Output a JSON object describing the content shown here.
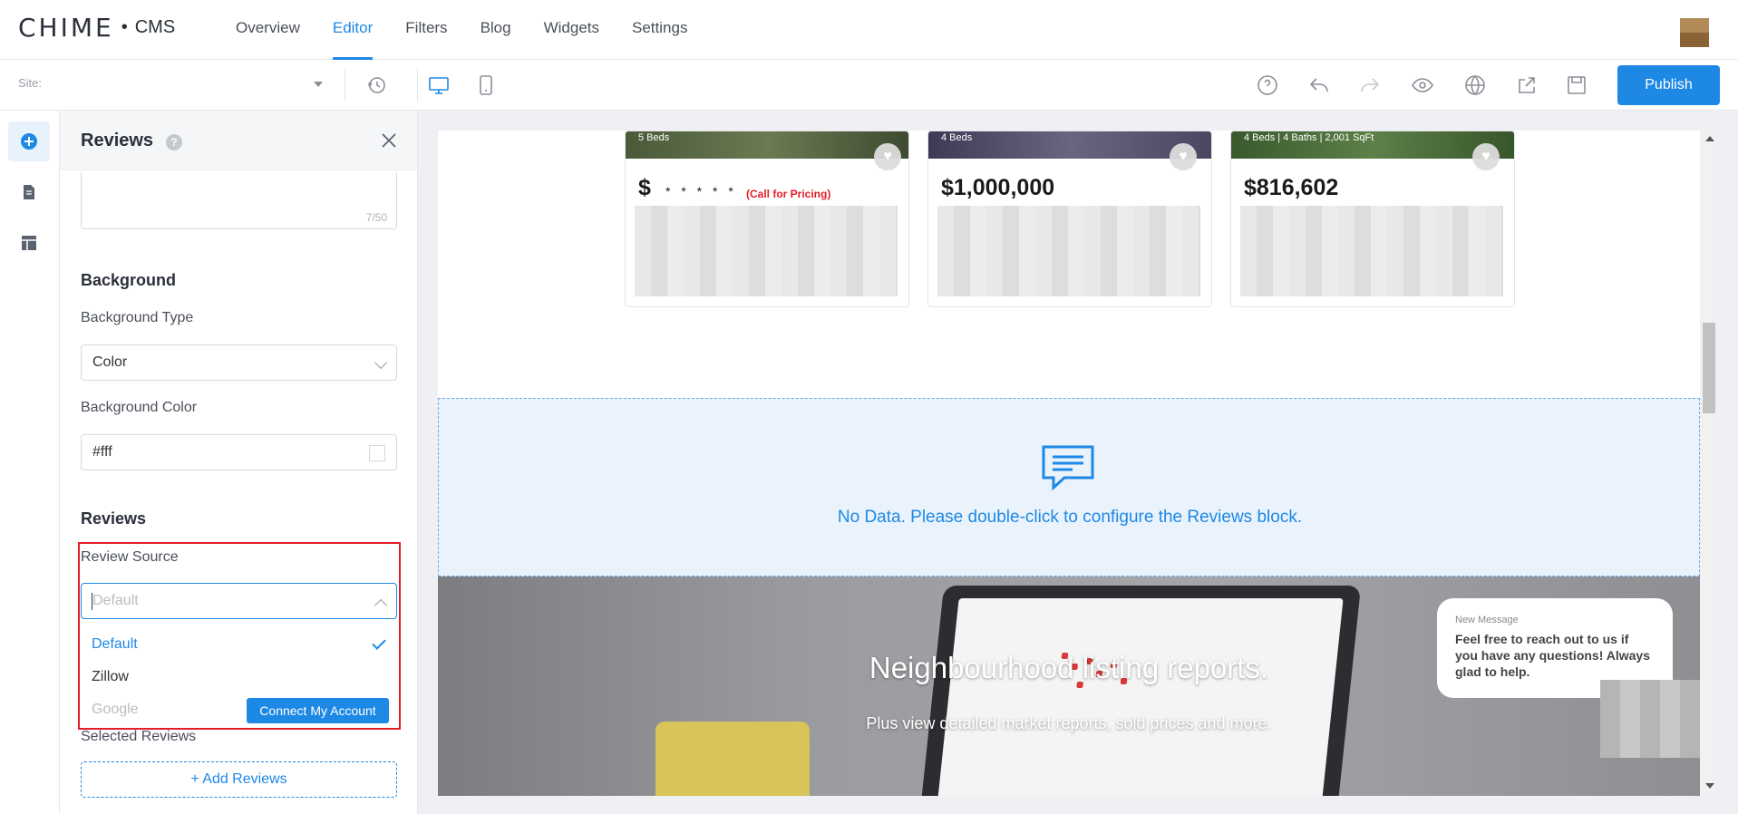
{
  "brand": {
    "logo_text": "CHIME",
    "logo_dot": "•",
    "logo_suffix": "CMS"
  },
  "nav": {
    "items": [
      {
        "label": "Overview"
      },
      {
        "label": "Editor",
        "active": true
      },
      {
        "label": "Filters"
      },
      {
        "label": "Blog"
      },
      {
        "label": "Widgets"
      },
      {
        "label": "Settings"
      }
    ]
  },
  "toolbar": {
    "site_label": "Site:",
    "icons": [
      "history-icon",
      "desktop-icon",
      "mobile-icon",
      "help-icon",
      "undo-icon",
      "redo-icon",
      "preview-icon",
      "globe-icon",
      "share-icon",
      "save-icon"
    ],
    "publish_label": "Publish"
  },
  "colors": {
    "accent": "#1e88e5",
    "highlight": "#e41e26",
    "price_note": "#e41e26"
  },
  "panel": {
    "title": "Reviews",
    "help_glyph": "?",
    "char_count": "7/50",
    "background": {
      "heading": "Background",
      "type_label": "Background Type",
      "type_value": "Color",
      "color_label": "Background Color",
      "color_value": "#fff"
    },
    "reviews": {
      "heading": "Reviews",
      "source_label": "Review Source",
      "source_placeholder": "Default",
      "options": [
        {
          "label": "Default",
          "selected": true
        },
        {
          "label": "Zillow"
        },
        {
          "label": "Google",
          "disabled": true
        }
      ],
      "connect_label": "Connect My Account",
      "selected_label": "Selected Reviews",
      "add_label": "+ Add Reviews"
    }
  },
  "canvas": {
    "listings": [
      {
        "meta": "5 Beds",
        "price_symbol": "$",
        "price_mask": "* * * * *",
        "price_note": "(Call for Pricing)"
      },
      {
        "meta": "4 Beds",
        "price": "$1,000,000"
      },
      {
        "meta": "4 Beds   |   4 Baths   |   2,001 SqFt",
        "price": "$816,602"
      }
    ],
    "reviews_block": {
      "message": "No Data. Please double-click to configure the Reviews block."
    },
    "hero": {
      "title": "Neighbourhood listing reports.",
      "subtitle": "Plus view detailed market reports, sold prices and more."
    },
    "chat": {
      "header": "New Message",
      "body": "Feel free to reach out to us if you have any questions! Always glad to help."
    }
  }
}
